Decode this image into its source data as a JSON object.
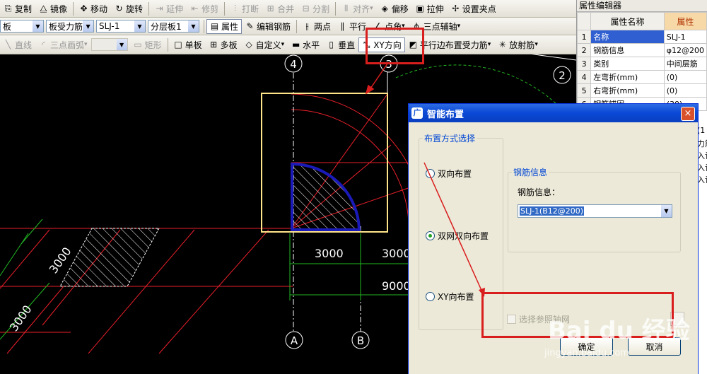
{
  "toolbar_row1": [
    {
      "label": "复制",
      "icon": "copy-icon",
      "glyph": "⎘",
      "disabled": false
    },
    {
      "label": "镜像",
      "icon": "mirror-icon",
      "glyph": "⧋",
      "disabled": false
    },
    {
      "sep": true
    },
    {
      "label": "移动",
      "icon": "move-icon",
      "glyph": "✥",
      "disabled": false
    },
    {
      "label": "旋转",
      "icon": "rotate-icon",
      "glyph": "↻",
      "disabled": false
    },
    {
      "sep": true
    },
    {
      "label": "延伸",
      "icon": "extend-icon",
      "glyph": "⇥",
      "disabled": true
    },
    {
      "label": "修剪",
      "icon": "trim-icon",
      "glyph": "⇤",
      "disabled": true
    },
    {
      "sep": true
    },
    {
      "label": "打断",
      "icon": "break-icon",
      "glyph": "⫶",
      "disabled": true
    },
    {
      "label": "合并",
      "icon": "merge-icon",
      "glyph": "⊞",
      "disabled": true
    },
    {
      "label": "分割",
      "icon": "split-icon",
      "glyph": "⊟",
      "disabled": true
    },
    {
      "sep": true
    },
    {
      "label": "对齐",
      "icon": "align-icon",
      "glyph": "⫴",
      "disabled": true,
      "dropdown": true
    },
    {
      "label": "偏移",
      "icon": "offset-icon",
      "glyph": "◈",
      "disabled": false
    },
    {
      "label": "拉伸",
      "icon": "stretch-icon",
      "glyph": "▣",
      "disabled": false
    },
    {
      "label": "设置夹点",
      "icon": "grip-icon",
      "glyph": "✢",
      "disabled": false
    }
  ],
  "toolbar_row2": {
    "combos": [
      {
        "value": "板",
        "width": 62
      },
      {
        "value": "板受力筋",
        "width": 68
      },
      {
        "value": "SLJ-1",
        "width": 70
      },
      {
        "value": "分层板1",
        "width": 73
      }
    ],
    "buttons": [
      {
        "label": "属性",
        "icon": "property-icon",
        "glyph": "▤",
        "pressed": true
      },
      {
        "label": "编辑钢筋",
        "icon": "edit-rebar-icon",
        "glyph": "✎",
        "pressed": false
      },
      {
        "sep": true
      },
      {
        "label": "两点",
        "icon": "two-point-icon",
        "glyph": "⫲",
        "pressed": false
      },
      {
        "label": "平行",
        "icon": "parallel-icon",
        "glyph": "∥",
        "pressed": false
      },
      {
        "label": "点角",
        "icon": "point-angle-icon",
        "glyph": "∠",
        "pressed": false,
        "dropdown": true
      },
      {
        "label": "三点辅轴",
        "icon": "three-point-axis-icon",
        "glyph": "⋔",
        "pressed": false,
        "dropdown": true
      }
    ]
  },
  "toolbar_row3": [
    {
      "label": "直线",
      "icon": "line-icon",
      "glyph": "╲",
      "disabled": true
    },
    {
      "label": "三点画弧",
      "icon": "arc-icon",
      "glyph": "◜",
      "disabled": true,
      "dropdown": true
    },
    {
      "combo": true
    },
    {
      "label": "矩形",
      "icon": "rect-icon",
      "glyph": "▭",
      "disabled": true
    },
    {
      "sep": true
    },
    {
      "label": "单板",
      "icon": "single-slab-icon",
      "glyph": "□",
      "disabled": false
    },
    {
      "label": "多板",
      "icon": "multi-slab-icon",
      "glyph": "⊞",
      "disabled": false
    },
    {
      "label": "自定义",
      "icon": "custom-icon",
      "glyph": "◇",
      "disabled": false,
      "dropdown": true
    },
    {
      "label": "水平",
      "icon": "horizontal-icon",
      "glyph": "▬",
      "disabled": false
    },
    {
      "label": "垂直",
      "icon": "vertical-icon",
      "glyph": "▯",
      "disabled": false
    },
    {
      "label": "XY方向",
      "icon": "xy-direction-icon",
      "glyph": "⤡",
      "disabled": false,
      "pressed": true
    },
    {
      "label": "平行边布置受力筋",
      "icon": "parallel-edge-icon",
      "glyph": "◩",
      "disabled": false,
      "dropdown": true
    },
    {
      "label": "放射筋",
      "icon": "radial-icon",
      "glyph": "✳",
      "disabled": false,
      "dropdown": true
    }
  ],
  "property_editor": {
    "title": "属性编辑器",
    "col_name": "属性名称",
    "col_value": "属性",
    "rows": [
      {
        "no": "1",
        "name": "名称",
        "value": "SLJ-1",
        "selected": true
      },
      {
        "no": "2",
        "name": "钢筋信息",
        "value": "φ12@200"
      },
      {
        "no": "3",
        "name": "类别",
        "value": "中间层筋"
      },
      {
        "no": "4",
        "name": "左弯折(mm)",
        "value": "(0)"
      },
      {
        "no": "5",
        "name": "右弯折(mm)",
        "value": "(0)"
      },
      {
        "no": "6",
        "name": "钢筋锚固",
        "value": "(30)"
      }
    ],
    "partial_values": [
      "(1",
      "力筋",
      "入计",
      "入计",
      "入计"
    ]
  },
  "canvas": {
    "axis_labels": {
      "top": [
        "4",
        "3",
        "2"
      ],
      "bottom": [
        "A",
        "B"
      ]
    },
    "dims": {
      "d1": "3000",
      "d2": "3000",
      "d3": "9000",
      "d4": "3000",
      "d5": "3000"
    }
  },
  "dialog": {
    "title": "智能布置",
    "close": "×",
    "group_layout": "布置方式选择",
    "radios": [
      {
        "label": "双向布置",
        "checked": false
      },
      {
        "label": "双网双向布置",
        "checked": true
      },
      {
        "label": "XY向布置",
        "checked": false
      }
    ],
    "group_rebar": "钢筋信息",
    "rebar_label": "钢筋信息：",
    "rebar_value": "SLJ-1(B12@200)",
    "checkbox_label": "选择参照轴网",
    "ok": "确定",
    "cancel": "取消"
  },
  "watermark": {
    "brand": "Bai du 经验",
    "url": "jingyan.baidu.com"
  }
}
